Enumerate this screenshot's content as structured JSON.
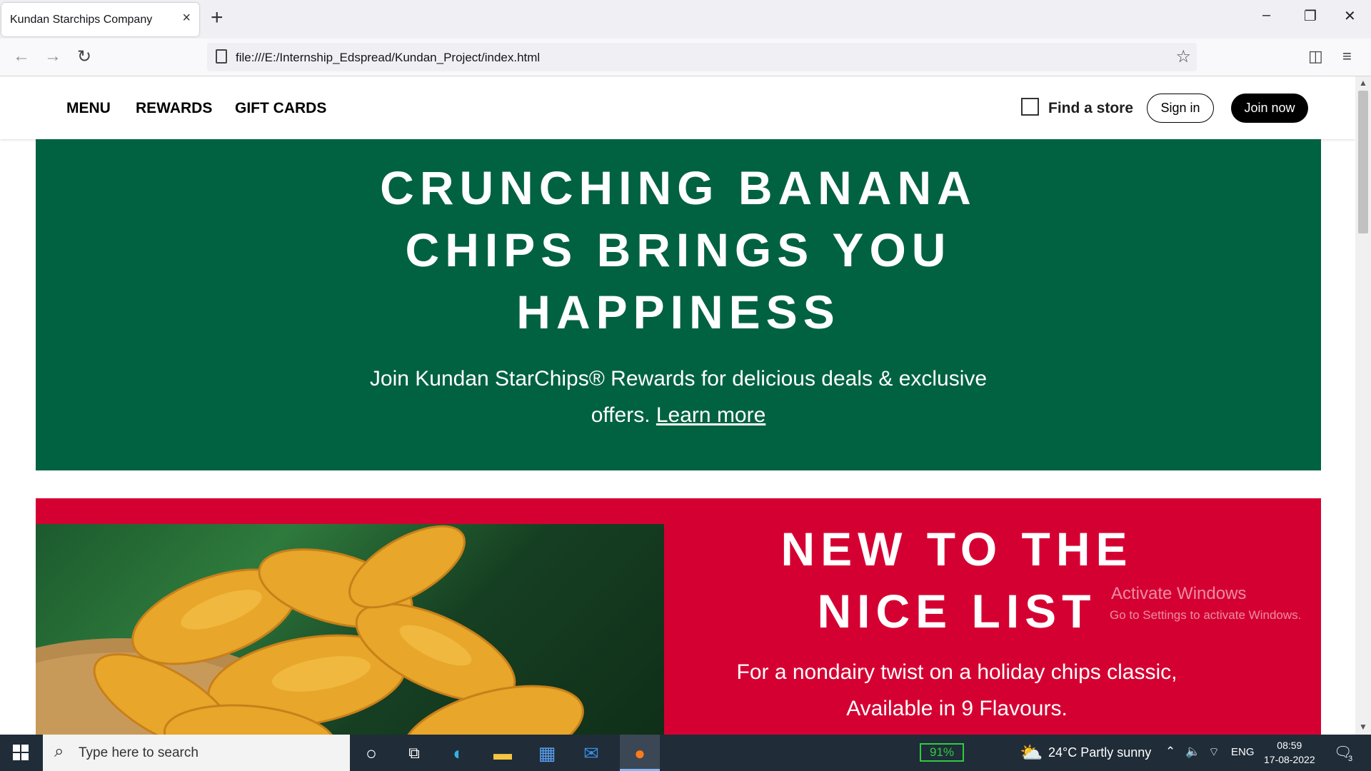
{
  "browser": {
    "tab_title": "Kundan Starchips Company",
    "tab_close": "×",
    "new_tab": "+",
    "url": "file:///E:/Internship_Edspread/Kundan_Project/index.html",
    "window_controls": [
      "–",
      "❐",
      "✕"
    ]
  },
  "site": {
    "nav": [
      "MENU",
      "REWARDS",
      "GIFT CARDS"
    ],
    "find_store": "Find a store",
    "sign_in": "Sign in",
    "join_now": "Join now"
  },
  "hero": {
    "title": "CRUNCHING BANANA CHIPS BRINGS YOU HAPPINESS",
    "text": "Join Kundan StarChips® Rewards for delicious deals & exclusive offers.",
    "link": "Learn more",
    "bg_color": "#006241"
  },
  "promo": {
    "title": "NEW TO THE NICE LIST",
    "text": "For a nondairy twist on a holiday chips classic, Available in 9 Flavours.",
    "bg_color": "#d50032"
  },
  "watermark": {
    "line1": "Activate Windows",
    "line2": "Go to Settings to activate Windows."
  },
  "taskbar": {
    "search_placeholder": "Type here to search",
    "battery": "91%",
    "weather": "24°C  Partly sunny",
    "language": "ENG",
    "time": "08:59",
    "date": "17-08-2022",
    "notifications": "3"
  }
}
